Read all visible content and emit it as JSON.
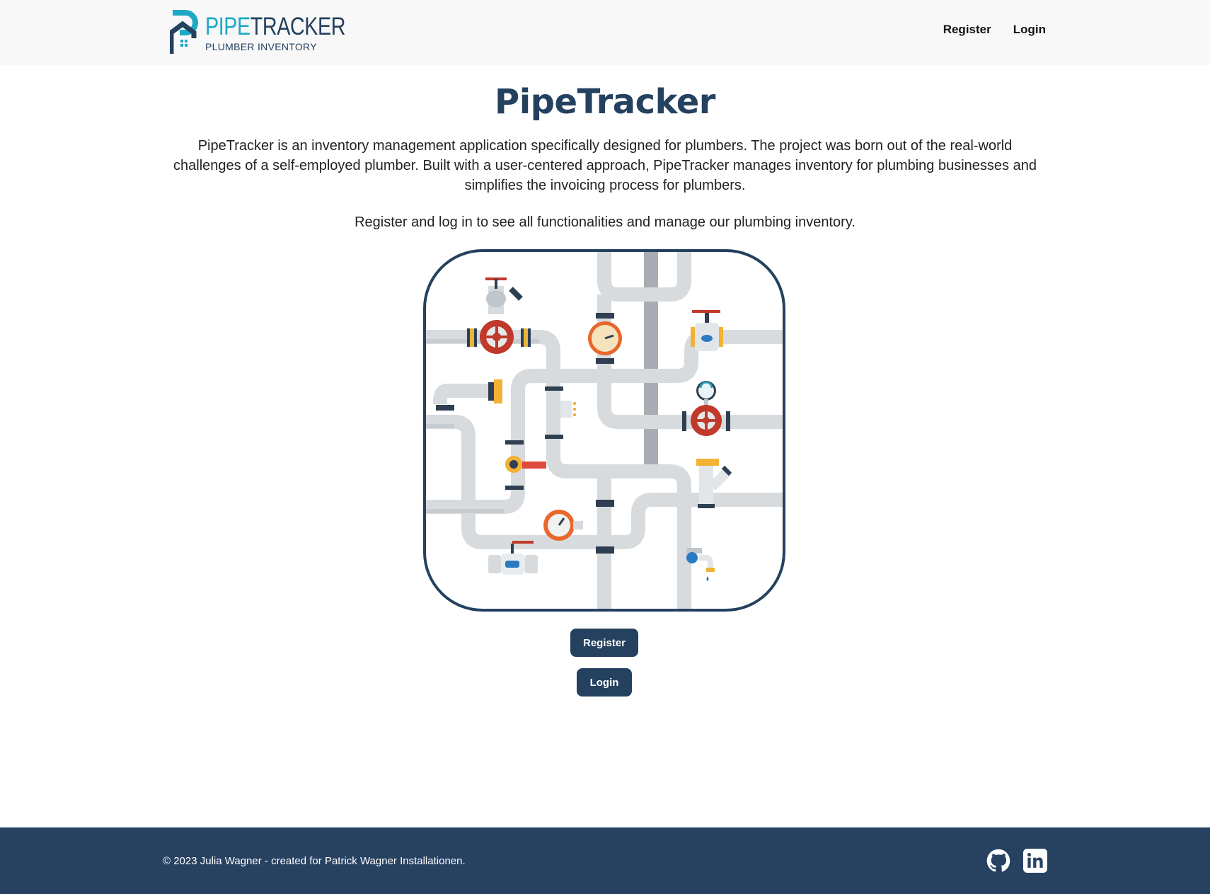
{
  "navbar": {
    "brand_pipe": "PIPE",
    "brand_tracker": "TRACKER",
    "brand_subtitle": "PLUMBER INVENTORY",
    "links": [
      {
        "label": "Register"
      },
      {
        "label": "Login"
      }
    ]
  },
  "main": {
    "title": "PipeTracker",
    "intro": "PipeTracker is an inventory management application specifically designed for plumbers. The project was born out of the real-world challenges of a self-employed plumber. Built with a user-centered approach, PipeTracker manages inventory for plumbing businesses and simplifies the invoicing process for plumbers.",
    "cta_text": "Register and log in to see all functionalities and manage our plumbing inventory.",
    "register_button": "Register",
    "login_button": "Login"
  },
  "footer": {
    "copyright": "© 2023 Julia Wagner - created for Patrick Wagner Installationen.",
    "icons": [
      "github-icon",
      "linkedin-icon"
    ]
  },
  "colors": {
    "primary": "#24415f",
    "accent": "#1da9c6",
    "navbar_bg": "#f8f8f8",
    "footer_bg": "#274161"
  }
}
